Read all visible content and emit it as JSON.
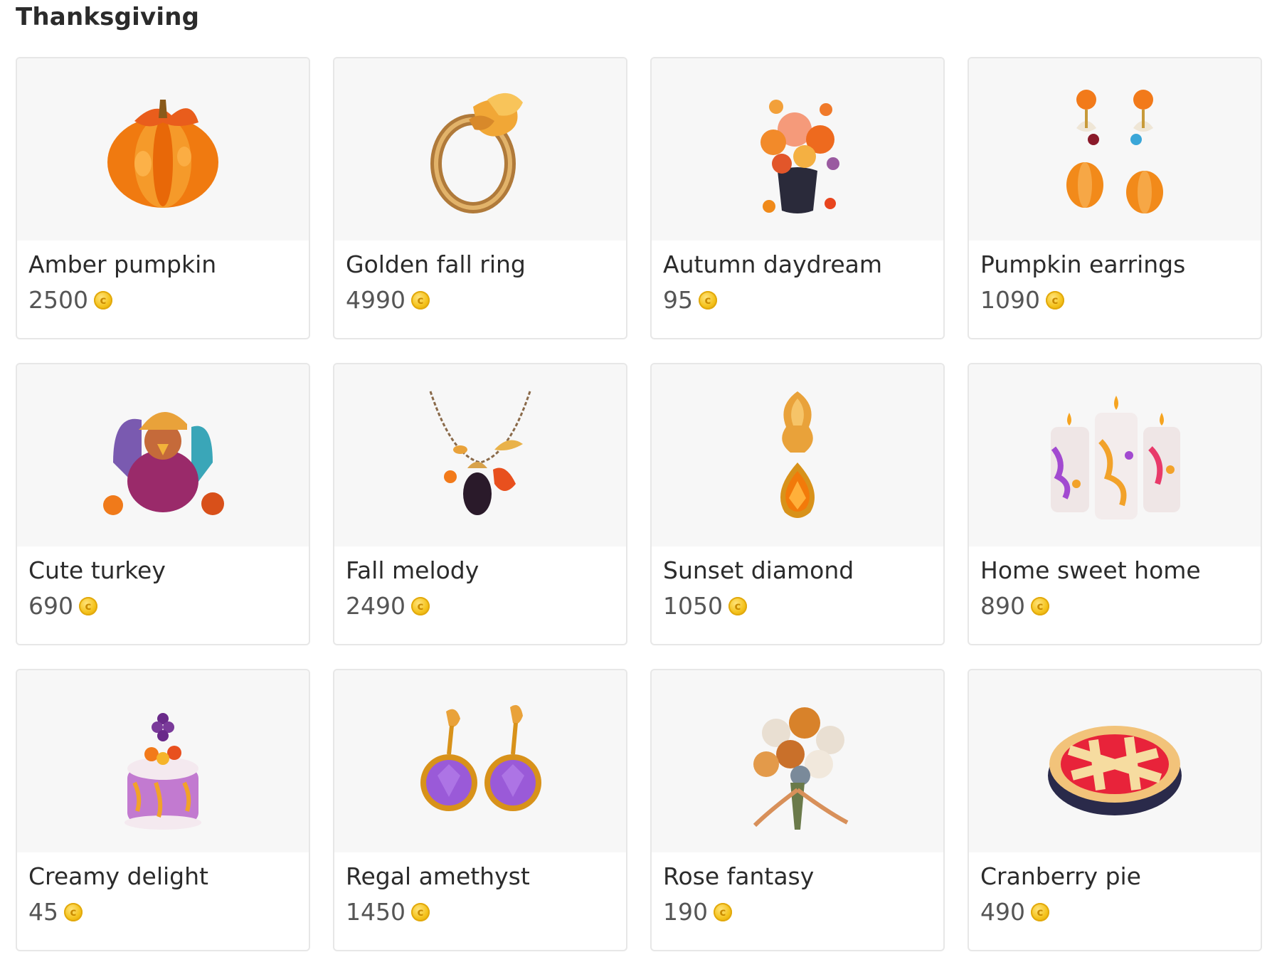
{
  "section": {
    "title": "Thanksgiving"
  },
  "currency_icon": "coin-icon",
  "items": [
    {
      "name": "Amber pumpkin",
      "price": "2500",
      "image": "pumpkin-image"
    },
    {
      "name": "Golden fall ring",
      "price": "4990",
      "image": "ring-image"
    },
    {
      "name": "Autumn daydream",
      "price": "95",
      "image": "flower-vase-image"
    },
    {
      "name": "Pumpkin earrings",
      "price": "1090",
      "image": "pumpkin-earrings-image"
    },
    {
      "name": "Cute turkey",
      "price": "690",
      "image": "turkey-image"
    },
    {
      "name": "Fall melody",
      "price": "2490",
      "image": "necklace-image"
    },
    {
      "name": "Sunset diamond",
      "price": "1050",
      "image": "pendant-image"
    },
    {
      "name": "Home sweet home",
      "price": "890",
      "image": "candles-image"
    },
    {
      "name": "Creamy delight",
      "price": "45",
      "image": "cake-image"
    },
    {
      "name": "Regal amethyst",
      "price": "1450",
      "image": "amethyst-earrings-image"
    },
    {
      "name": "Rose fantasy",
      "price": "190",
      "image": "rose-bouquet-image"
    },
    {
      "name": "Cranberry pie",
      "price": "490",
      "image": "pie-image"
    }
  ]
}
